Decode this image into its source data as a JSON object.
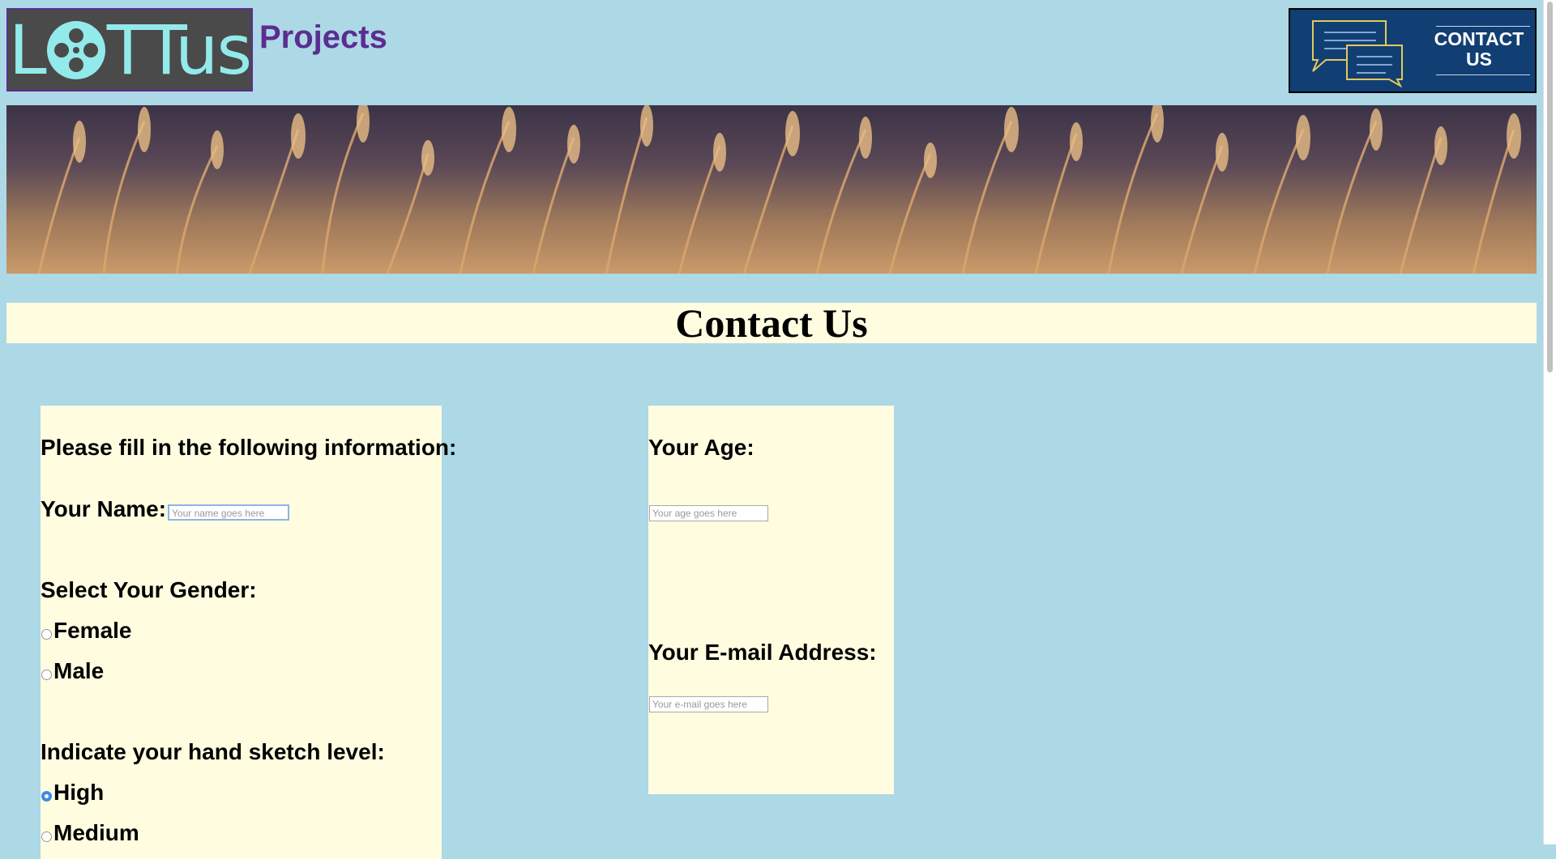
{
  "header": {
    "logo_text_1": "L",
    "logo_text_2": "TTus",
    "section": "Projects",
    "contact_button_line1": "CONTACT",
    "contact_button_line2": "US"
  },
  "page": {
    "title": "Contact Us"
  },
  "form": {
    "intro": "Please fill in the following information:",
    "name_label": "Your Name:",
    "name_placeholder": "Your name goes here",
    "gender_label": "Select Your Gender:",
    "gender_options": [
      "Female",
      "Male"
    ],
    "sketch_label": "Indicate your hand sketch level:",
    "sketch_options": [
      "High",
      "Medium"
    ],
    "sketch_selected": "High",
    "age_label": "Your Age:",
    "age_placeholder": "Your age goes here",
    "email_label": "Your E-mail Address:",
    "email_placeholder": "Your e-mail goes here"
  },
  "colors": {
    "page_bg": "#add8e6",
    "panel_bg": "#fffce0",
    "logo_bg": "#4a4a4a",
    "logo_fg": "#93eaea",
    "brand_purple": "#5b2d91",
    "contact_bg": "#123f73"
  }
}
